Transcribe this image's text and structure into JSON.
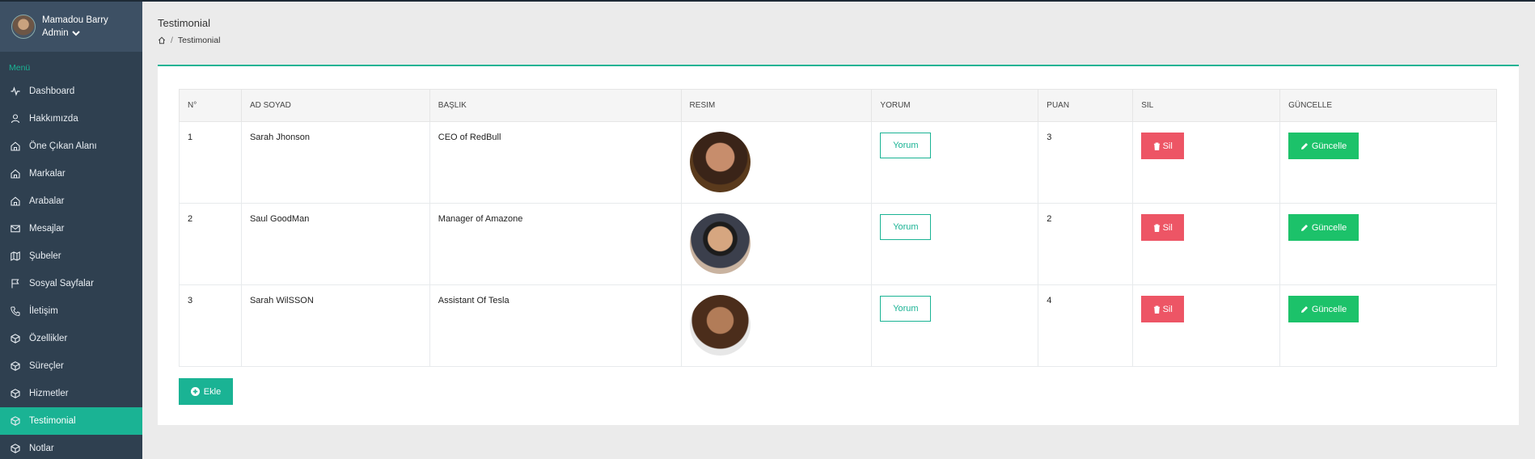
{
  "user": {
    "name": "Mamadou Barry",
    "role": "Admin"
  },
  "sidebar": {
    "menu_title": "Menü",
    "items": [
      {
        "label": "Dashboard",
        "icon": "activity-icon"
      },
      {
        "label": "Hakkımızda",
        "icon": "user-icon"
      },
      {
        "label": "Öne Çıkan Alanı",
        "icon": "home-icon"
      },
      {
        "label": "Markalar",
        "icon": "home-icon"
      },
      {
        "label": "Arabalar",
        "icon": "home-icon"
      },
      {
        "label": "Mesajlar",
        "icon": "mail-icon"
      },
      {
        "label": "Şubeler",
        "icon": "map-icon"
      },
      {
        "label": "Sosyal Sayfalar",
        "icon": "flag-icon"
      },
      {
        "label": "İletişim",
        "icon": "phone-icon"
      },
      {
        "label": "Özellikler",
        "icon": "box-icon"
      },
      {
        "label": "Süreçler",
        "icon": "box-icon"
      },
      {
        "label": "Hizmetler",
        "icon": "box-icon"
      },
      {
        "label": "Testimonial",
        "icon": "box-icon",
        "active": true
      },
      {
        "label": "Notlar",
        "icon": "box-icon"
      }
    ]
  },
  "header": {
    "title": "Testimonial",
    "breadcrumb": "Testimonial"
  },
  "table": {
    "columns": [
      "N°",
      "AD SOYAD",
      "BAŞLIK",
      "RESIM",
      "YORUM",
      "PUAN",
      "SIL",
      "GÜNCELLE"
    ],
    "rows": [
      {
        "no": "1",
        "name": "Sarah Jhonson",
        "title": "CEO of RedBull",
        "puan": "3"
      },
      {
        "no": "2",
        "name": "Saul GoodMan",
        "title": "Manager of Amazone",
        "puan": "2"
      },
      {
        "no": "3",
        "name": "Sarah WilSSON",
        "title": "Assistant Of Tesla",
        "puan": "4"
      }
    ],
    "yorum_label": "Yorum",
    "sil_label": "Sil",
    "guncelle_label": "Güncelle"
  },
  "ekle_label": "Ekle",
  "colors": {
    "sidebar_bg": "#2f4050",
    "accent": "#1ab394",
    "danger": "#ed5565",
    "success": "#1cc26a"
  }
}
